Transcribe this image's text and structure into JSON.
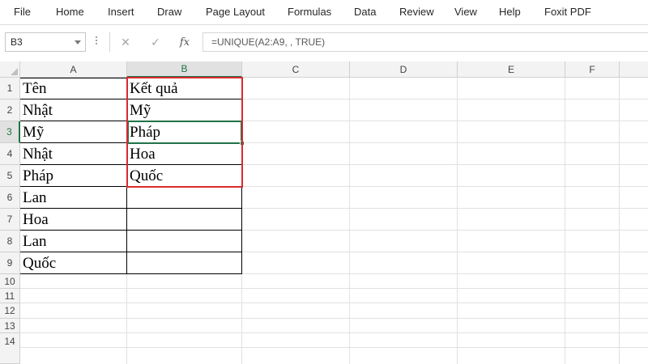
{
  "ribbon": {
    "tabs": [
      "File",
      "Home",
      "Insert",
      "Draw",
      "Page Layout",
      "Formulas",
      "Data",
      "Review",
      "View",
      "Help",
      "Foxit PDF"
    ]
  },
  "formula_bar": {
    "name_box": "B3",
    "cancel_glyph": "✕",
    "enter_glyph": "✓",
    "fx_label": "fx",
    "formula": "=UNIQUE(A2:A9, , TRUE)"
  },
  "columns": [
    "A",
    "B",
    "C",
    "D",
    "E",
    "F"
  ],
  "rows": [
    "1",
    "2",
    "3",
    "4",
    "5",
    "6",
    "7",
    "8",
    "9",
    "10",
    "11",
    "12",
    "13",
    "14"
  ],
  "cells": {
    "A": [
      "Tên",
      "Nhật",
      "Mỹ",
      "Nhật",
      "Pháp",
      "Lan",
      "Hoa",
      "Lan",
      "Quốc"
    ],
    "B": [
      "Kết quả",
      "Mỹ",
      "Pháp",
      "Hoa",
      "Quốc",
      "",
      "",
      "",
      ""
    ]
  },
  "colors": {
    "accent": "#217346",
    "spill_highlight": "#d92a2f"
  }
}
